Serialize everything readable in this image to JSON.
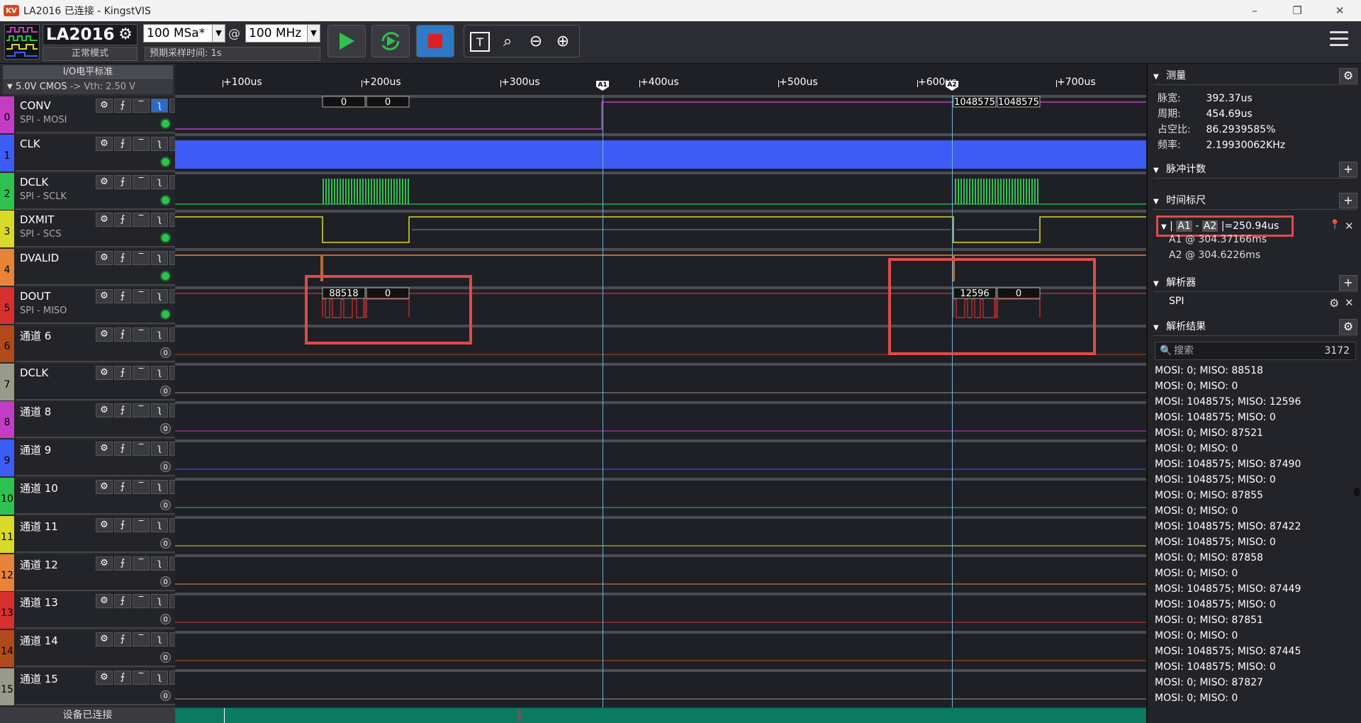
{
  "window": {
    "title": "LA2016 已连接 - KingstVIS",
    "icon": "kingst-logo-icon",
    "min": "–",
    "max": "❐",
    "close": "✕"
  },
  "toolbar": {
    "device": "LA2016",
    "mode": "正常模式",
    "sample_rate": "100 MSa*",
    "at": "@",
    "bandwidth": "100 MHz",
    "presample": "预期采样时间: 1s"
  },
  "left": {
    "io_header": "I/O电平标准",
    "io_level": "5.0V CMOS",
    "io_vth": "-> Vth: 2.50 V",
    "device_status": "设备已连接",
    "channels": [
      {
        "num": "0",
        "name": "CONV",
        "sub": "SPI - MOSI",
        "color": "#c43cc4",
        "ind": "on"
      },
      {
        "num": "1",
        "name": "CLK",
        "sub": "",
        "color": "#3d5cf5",
        "ind": "on"
      },
      {
        "num": "2",
        "name": "DCLK",
        "sub": "SPI - SCLK",
        "color": "#2ec24e",
        "ind": "on"
      },
      {
        "num": "3",
        "name": "DXMIT",
        "sub": "SPI - SCS",
        "color": "#d9d92a",
        "ind": "on"
      },
      {
        "num": "4",
        "name": "DVALID",
        "sub": "",
        "color": "#e8843a",
        "ind": "on"
      },
      {
        "num": "5",
        "name": "DOUT",
        "sub": "SPI - MISO",
        "color": "#d63030",
        "ind": "on"
      },
      {
        "num": "6",
        "name": "通道 6",
        "sub": "",
        "color": "#b04a1a",
        "ind": "off",
        "count": "0"
      },
      {
        "num": "7",
        "name": "DCLK",
        "sub": "",
        "color": "#9a9a8a",
        "ind": "off",
        "count": "0"
      },
      {
        "num": "8",
        "name": "通道 8",
        "sub": "",
        "color": "#c43cc4",
        "ind": "off",
        "count": "0"
      },
      {
        "num": "9",
        "name": "通道 9",
        "sub": "",
        "color": "#3d5cf5",
        "ind": "off",
        "count": "0"
      },
      {
        "num": "10",
        "name": "通道 10",
        "sub": "",
        "color": "#2ec24e",
        "ind": "off",
        "count": "0"
      },
      {
        "num": "11",
        "name": "通道 11",
        "sub": "",
        "color": "#d9d92a",
        "ind": "off",
        "count": "0"
      },
      {
        "num": "12",
        "name": "通道 12",
        "sub": "",
        "color": "#e8843a",
        "ind": "off",
        "count": "0"
      },
      {
        "num": "13",
        "name": "通道 13",
        "sub": "",
        "color": "#d63030",
        "ind": "off",
        "count": "0"
      },
      {
        "num": "14",
        "name": "通道 14",
        "sub": "",
        "color": "#b04a1a",
        "ind": "off",
        "count": "0"
      },
      {
        "num": "15",
        "name": "通道 15",
        "sub": "",
        "color": "#9a9a8a",
        "ind": "off",
        "count": "0"
      }
    ]
  },
  "wave": {
    "ticks": [
      "+100us",
      "+200us",
      "+300us",
      "+400us",
      "+500us",
      "+600us",
      "+700us"
    ],
    "marker_a1": "A1",
    "marker_a2": "A2",
    "conv_labels": [
      "0",
      "0",
      "1048575",
      "1048575"
    ],
    "dout_labels": [
      "88518",
      "0",
      "12596",
      "0"
    ]
  },
  "right": {
    "measure_title": "测量",
    "measure": [
      {
        "k": "脉宽:",
        "v": "392.37us"
      },
      {
        "k": "周期:",
        "v": "454.69us"
      },
      {
        "k": "占空比:",
        "v": "86.2939585%"
      },
      {
        "k": "频率:",
        "v": "2.19930062KHz"
      }
    ],
    "pulse_title": "脉冲计数",
    "timemark_title": "时间标尺",
    "tm_bar": "|",
    "tm_a1": "A1",
    "tm_dash": "-",
    "tm_a2": "A2",
    "tm_value": "|=250.94us",
    "tm_a1_at": "A1 @ 304.37166ms",
    "tm_a2_at": "A2 @ 304.6226ms",
    "analyzer_title": "解析器",
    "analyzer_item": "SPI",
    "results_title": "解析结果",
    "search_placeholder": "搜索",
    "search_count": "3172",
    "results": [
      "MOSI: 0;  MISO: 88518",
      "MOSI: 0;  MISO: 0",
      "MOSI: 1048575;  MISO: 12596",
      "MOSI: 1048575;  MISO: 0",
      "MOSI: 0;  MISO: 87521",
      "MOSI: 0;  MISO: 0",
      "MOSI: 1048575;  MISO: 87490",
      "MOSI: 1048575;  MISO: 0",
      "MOSI: 0;  MISO: 87855",
      "MOSI: 0;  MISO: 0",
      "MOSI: 1048575;  MISO: 87422",
      "MOSI: 1048575;  MISO: 0",
      "MOSI: 0;  MISO: 87858",
      "MOSI: 0;  MISO: 0",
      "MOSI: 1048575;  MISO: 87449",
      "MOSI: 1048575;  MISO: 0",
      "MOSI: 0;  MISO: 87851",
      "MOSI: 0;  MISO: 0",
      "MOSI: 1048575;  MISO: 87445",
      "MOSI: 1048575;  MISO: 0",
      "MOSI: 0;  MISO: 87827",
      "MOSI: 0;  MISO: 0"
    ]
  }
}
